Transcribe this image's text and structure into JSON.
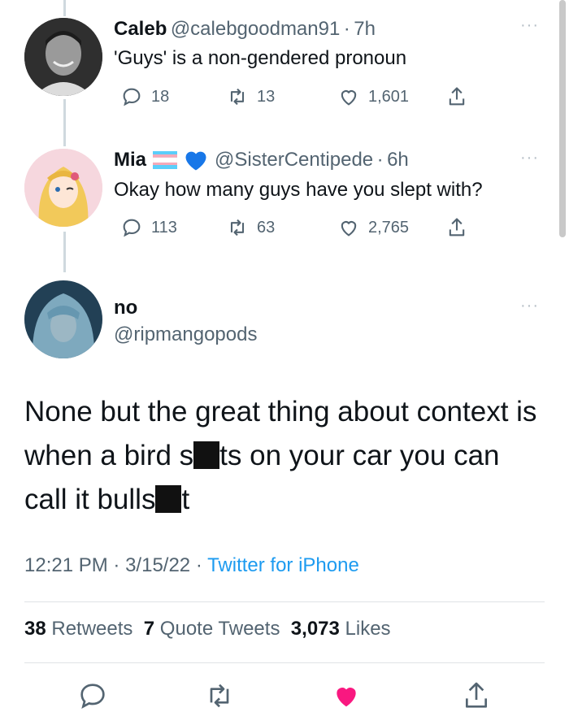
{
  "tweets": [
    {
      "name": "Caleb",
      "handle": "@calebgoodman91",
      "time": "7h",
      "text": "'Guys' is a non-gendered pronoun",
      "replies": "18",
      "retweets": "13",
      "likes": "1,601"
    },
    {
      "name": "Mia",
      "handle": "@SisterCentipede",
      "time": "6h",
      "text": "Okay how many guys have you slept with?",
      "replies": "113",
      "retweets": "63",
      "likes": "2,765"
    }
  ],
  "main": {
    "name": "no",
    "handle": "@ripmangopods",
    "text_part1": "None but the great thing about context is when a bird s",
    "text_part2": "ts on your car you can call it bulls",
    "text_part3": "t",
    "time": "12:21 PM",
    "date": "3/15/22",
    "source": "Twitter for iPhone",
    "retweets_count": "38",
    "retweets_label": "Retweets",
    "quotes_count": "7",
    "quotes_label": "Quote Tweets",
    "likes_count": "3,073",
    "likes_label": "Likes"
  },
  "separator": "·",
  "more": "···",
  "colors": {
    "like": "#f91880",
    "link": "#1d9bf0",
    "muted": "#536471"
  },
  "icons": [
    "reply-icon",
    "retweet-icon",
    "like-icon",
    "share-icon",
    "trans-flag-icon",
    "blue-heart-icon"
  ]
}
